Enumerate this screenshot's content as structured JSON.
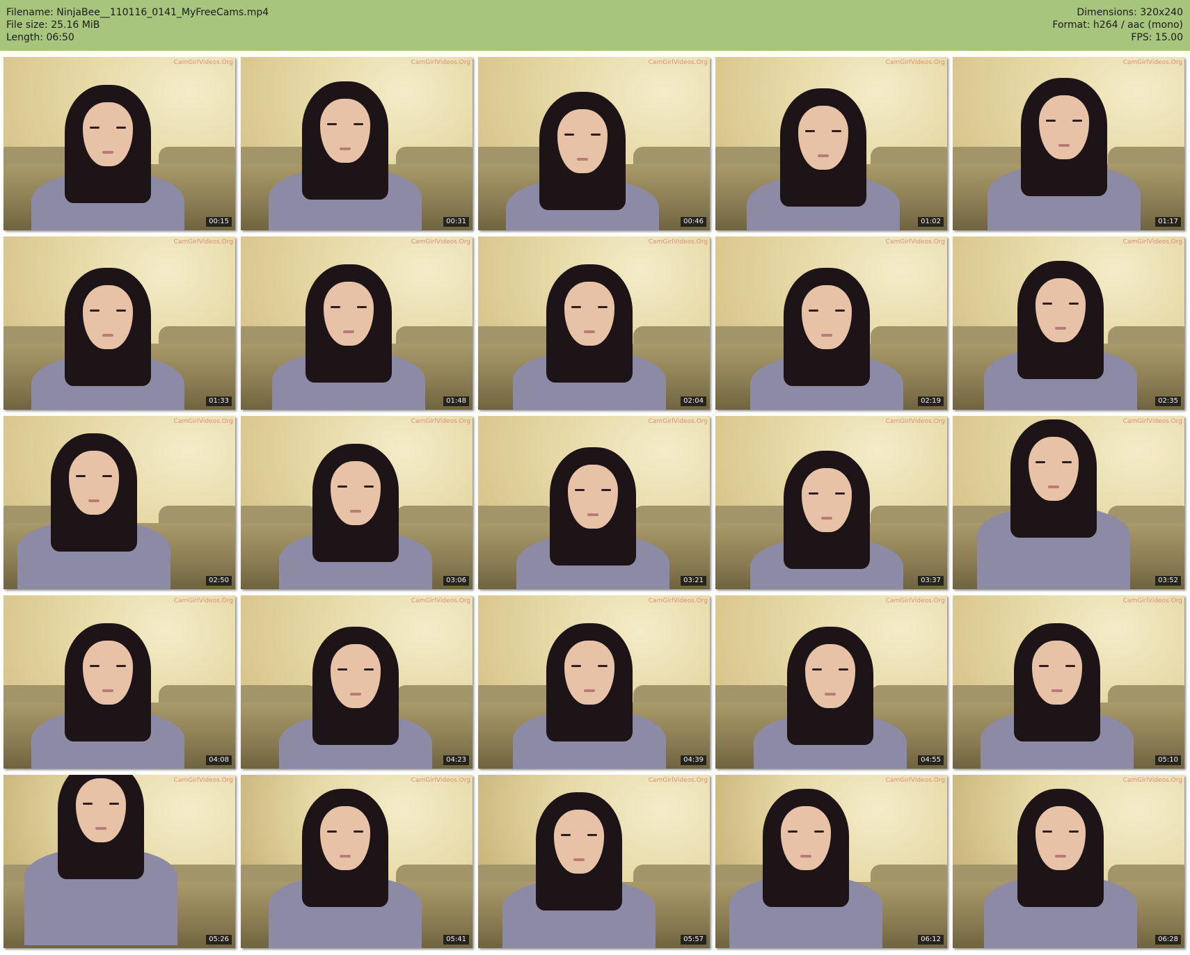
{
  "header": {
    "filename_line": "Filename: NinjaBee__110116_0141_MyFreeCams.mp4",
    "filesize_line": "File size: 25.16 MiB",
    "length_line": "Length: 06:50",
    "dimensions_line": "Dimensions: 320x240",
    "format_line": "Format: h264 / aac (mono)",
    "fps_line": "FPS: 15.00"
  },
  "watermark_text": "CamGirlVideos.Org",
  "thumbnails": [
    {
      "time": "00:15"
    },
    {
      "time": "00:31"
    },
    {
      "time": "00:46"
    },
    {
      "time": "01:02"
    },
    {
      "time": "01:17"
    },
    {
      "time": "01:33"
    },
    {
      "time": "01:48"
    },
    {
      "time": "02:04"
    },
    {
      "time": "02:19"
    },
    {
      "time": "02:35"
    },
    {
      "time": "02:50"
    },
    {
      "time": "03:06"
    },
    {
      "time": "03:21"
    },
    {
      "time": "03:37"
    },
    {
      "time": "03:52"
    },
    {
      "time": "04:08"
    },
    {
      "time": "04:23"
    },
    {
      "time": "04:39"
    },
    {
      "time": "04:55"
    },
    {
      "time": "05:10"
    },
    {
      "time": "05:26"
    },
    {
      "time": "05:41"
    },
    {
      "time": "05:57"
    },
    {
      "time": "06:12"
    },
    {
      "time": "06:28"
    }
  ],
  "colors": {
    "header_bg": "#a8c57e",
    "wall_light": "#f4ecc9",
    "wall_warm": "#cdb77a",
    "hair": "#1d1418",
    "shirt": "#8d8aa6",
    "stamp_bg": "#141414"
  }
}
